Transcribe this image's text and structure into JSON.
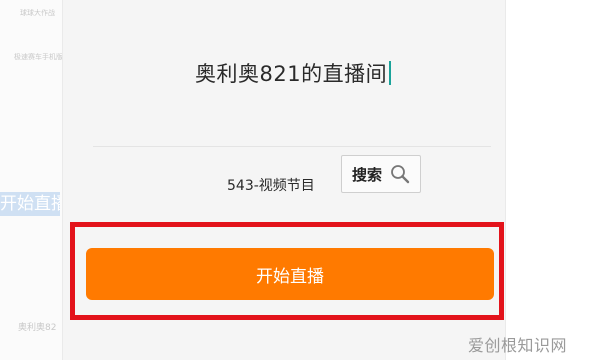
{
  "background_app": {
    "item1": "球球大作战",
    "item2": "极速赛车手机版",
    "selected_text": "开始直播",
    "bottom_text": "奥利奥82"
  },
  "dialog": {
    "room_title": "奥利奥821的直播间",
    "category": "543-视频节目",
    "search_label": "搜索",
    "start_live_label": "开始直播"
  },
  "colors": {
    "accent": "#ff7a00",
    "highlight": "#e3131b"
  },
  "watermark": "爱创根知识网"
}
